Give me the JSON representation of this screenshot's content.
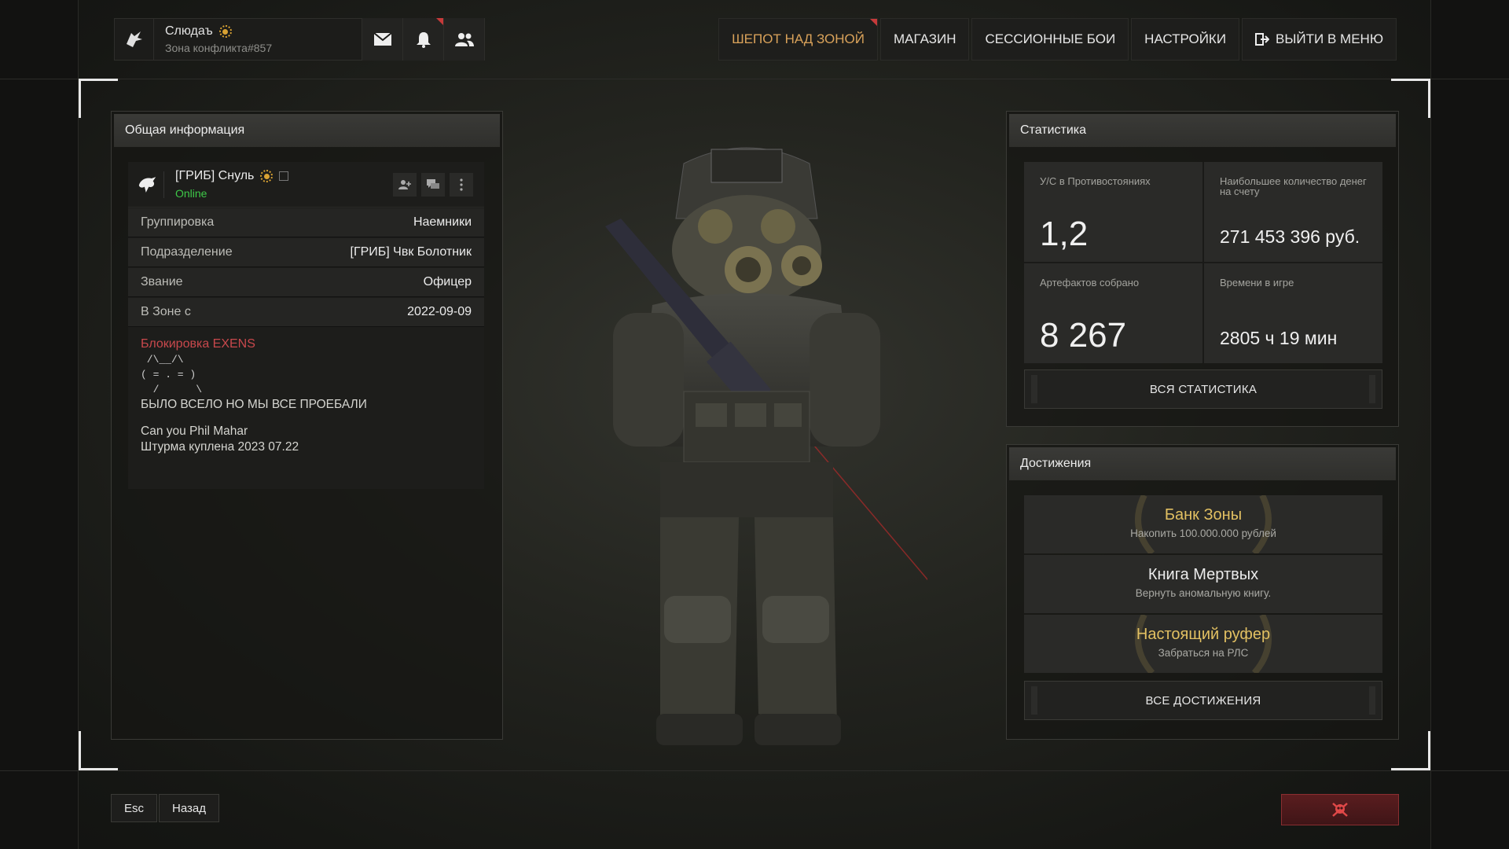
{
  "colors": {
    "accent_gold": "#d9a233",
    "online_green": "#3ec948",
    "block_red": "#c8484c",
    "achievement_gold": "#e2c062",
    "achievement_white": "#ececec"
  },
  "profile": {
    "name": "Слюдаъ",
    "subtitle": "Зона конфликта#857",
    "icons": [
      "mail-icon",
      "bell-icon",
      "friends-icon"
    ]
  },
  "nav": {
    "items": [
      {
        "label": "ШЕПОТ НАД ЗОНОЙ",
        "active": true
      },
      {
        "label": "МАГАЗИН"
      },
      {
        "label": "СЕССИОННЫЕ БОИ"
      },
      {
        "label": "НАСТРОЙКИ"
      },
      {
        "label": "ВЫЙТИ В МЕНЮ",
        "icon": "exit-icon"
      }
    ]
  },
  "general": {
    "title": "Общая информация",
    "user_name": "[ГРИБ] Снуль",
    "status": "Online",
    "rows": [
      {
        "key": "Группировка",
        "value": "Наемники"
      },
      {
        "key": "Подразделение",
        "value": "[ГРИБ] Чвк Болотник"
      },
      {
        "key": "Звание",
        "value": "Офицер"
      },
      {
        "key": "В Зоне с",
        "value": "2022-09-09"
      }
    ],
    "bio": {
      "block_label": "Блокировка EXENS",
      "ascii": " /\\__/\\\n( = . = )\n  /      \\",
      "line1": "БЫЛО ВСЕЛО НО МЫ ВСЕ ПРОЕБАЛИ",
      "line2": "Can you Phil Mahar",
      "line3": "Штурма куплена 2023 07.22"
    }
  },
  "stats": {
    "title": "Статистика",
    "cells": [
      {
        "label": "У/С в Противостояниях",
        "value": "1,2"
      },
      {
        "label": "Наибольшее количество денег на счету",
        "value": "271 453 396 руб."
      },
      {
        "label": "Артефактов собрано",
        "value": "8 267"
      },
      {
        "label": "Времени в игре",
        "value": "2805 ч 19 мин"
      }
    ],
    "all_button": "ВСЯ СТАТИСТИКА"
  },
  "achievements": {
    "title": "Достижения",
    "items": [
      {
        "title": "Банк Зоны",
        "desc": "Накопить 100.000.000 рублей",
        "rarity": "gold"
      },
      {
        "title": "Книга Мертвых",
        "desc": "Вернуть аномальную книгу.",
        "rarity": "white"
      },
      {
        "title": "Настоящий руфер",
        "desc": "Забраться на РЛС",
        "rarity": "gold"
      }
    ],
    "all_button": "ВСЕ ДОСТИЖЕНИЯ"
  },
  "footer": {
    "esc_key": "Esc",
    "back_label": "Назад",
    "kill_icon": "skull-crossbones-icon"
  }
}
